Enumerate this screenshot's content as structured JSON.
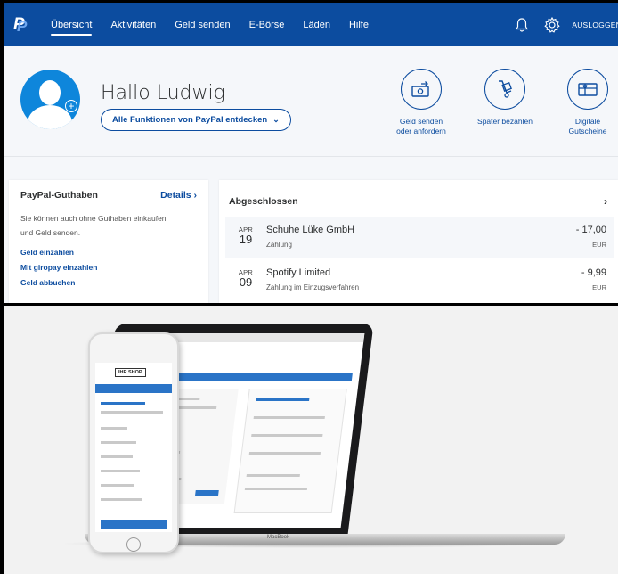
{
  "nav": {
    "items": [
      "Übersicht",
      "Aktivitäten",
      "Geld senden",
      "E-Börse",
      "Läden",
      "Hilfe"
    ],
    "active_index": 0,
    "logout": "AUSLOGGEN"
  },
  "hero": {
    "greeting": "Hallo Ludwig",
    "features_button": "Alle Funktionen von PayPal entdecken",
    "quick_actions": [
      {
        "icon": "send-money-icon",
        "line1": "Geld senden",
        "line2": "oder anfordern"
      },
      {
        "icon": "pay-later-icon",
        "line1": "Später bezahlen",
        "line2": ""
      },
      {
        "icon": "gift-card-icon",
        "line1": "Digitale",
        "line2": "Gutscheine"
      }
    ]
  },
  "balance": {
    "title": "PayPal-Guthaben",
    "details": "Details",
    "desc_line1": "Sie können auch ohne Guthaben einkaufen",
    "desc_line2": "und Geld senden.",
    "links": [
      "Geld einzahlen",
      "Mit giropay einzahlen",
      "Geld abbuchen"
    ]
  },
  "completed": {
    "title": "Abgeschlossen",
    "transactions": [
      {
        "month": "APR",
        "day": "19",
        "name": "Schuhe Lüke GmbH",
        "type": "Zahlung",
        "amount": "- 17,00",
        "currency": "EUR"
      },
      {
        "month": "APR",
        "day": "09",
        "name": "Spotify Limited",
        "type": "Zahlung im Einzugsverfahren",
        "amount": "- 9,99",
        "currency": "EUR"
      }
    ]
  },
  "devices": {
    "shop_logo": "IHR SHOP",
    "laptop_brand": "MacBook"
  },
  "colors": {
    "brand_blue": "#0c4c9f",
    "avatar_blue": "#0e86db",
    "page_bg": "#f5f7fa"
  }
}
